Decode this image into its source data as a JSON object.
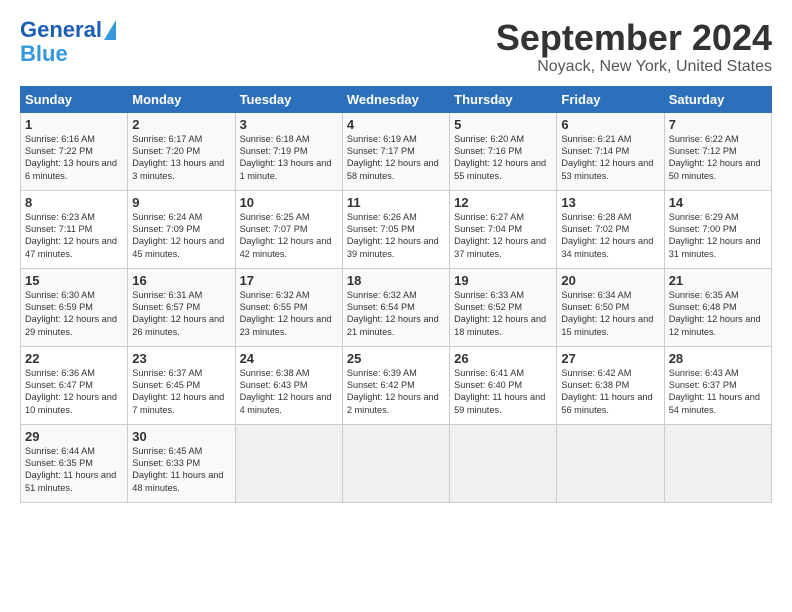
{
  "logo": {
    "line1": "General",
    "line2": "Blue"
  },
  "title": "September 2024",
  "subtitle": "Noyack, New York, United States",
  "days_of_week": [
    "Sunday",
    "Monday",
    "Tuesday",
    "Wednesday",
    "Thursday",
    "Friday",
    "Saturday"
  ],
  "weeks": [
    [
      {
        "day": "1",
        "sunrise": "6:16 AM",
        "sunset": "7:22 PM",
        "daylight": "13 hours and 6 minutes."
      },
      {
        "day": "2",
        "sunrise": "6:17 AM",
        "sunset": "7:20 PM",
        "daylight": "13 hours and 3 minutes."
      },
      {
        "day": "3",
        "sunrise": "6:18 AM",
        "sunset": "7:19 PM",
        "daylight": "13 hours and 1 minute."
      },
      {
        "day": "4",
        "sunrise": "6:19 AM",
        "sunset": "7:17 PM",
        "daylight": "12 hours and 58 minutes."
      },
      {
        "day": "5",
        "sunrise": "6:20 AM",
        "sunset": "7:16 PM",
        "daylight": "12 hours and 55 minutes."
      },
      {
        "day": "6",
        "sunrise": "6:21 AM",
        "sunset": "7:14 PM",
        "daylight": "12 hours and 53 minutes."
      },
      {
        "day": "7",
        "sunrise": "6:22 AM",
        "sunset": "7:12 PM",
        "daylight": "12 hours and 50 minutes."
      }
    ],
    [
      {
        "day": "8",
        "sunrise": "6:23 AM",
        "sunset": "7:11 PM",
        "daylight": "12 hours and 47 minutes."
      },
      {
        "day": "9",
        "sunrise": "6:24 AM",
        "sunset": "7:09 PM",
        "daylight": "12 hours and 45 minutes."
      },
      {
        "day": "10",
        "sunrise": "6:25 AM",
        "sunset": "7:07 PM",
        "daylight": "12 hours and 42 minutes."
      },
      {
        "day": "11",
        "sunrise": "6:26 AM",
        "sunset": "7:05 PM",
        "daylight": "12 hours and 39 minutes."
      },
      {
        "day": "12",
        "sunrise": "6:27 AM",
        "sunset": "7:04 PM",
        "daylight": "12 hours and 37 minutes."
      },
      {
        "day": "13",
        "sunrise": "6:28 AM",
        "sunset": "7:02 PM",
        "daylight": "12 hours and 34 minutes."
      },
      {
        "day": "14",
        "sunrise": "6:29 AM",
        "sunset": "7:00 PM",
        "daylight": "12 hours and 31 minutes."
      }
    ],
    [
      {
        "day": "15",
        "sunrise": "6:30 AM",
        "sunset": "6:59 PM",
        "daylight": "12 hours and 29 minutes."
      },
      {
        "day": "16",
        "sunrise": "6:31 AM",
        "sunset": "6:57 PM",
        "daylight": "12 hours and 26 minutes."
      },
      {
        "day": "17",
        "sunrise": "6:32 AM",
        "sunset": "6:55 PM",
        "daylight": "12 hours and 23 minutes."
      },
      {
        "day": "18",
        "sunrise": "6:32 AM",
        "sunset": "6:54 PM",
        "daylight": "12 hours and 21 minutes."
      },
      {
        "day": "19",
        "sunrise": "6:33 AM",
        "sunset": "6:52 PM",
        "daylight": "12 hours and 18 minutes."
      },
      {
        "day": "20",
        "sunrise": "6:34 AM",
        "sunset": "6:50 PM",
        "daylight": "12 hours and 15 minutes."
      },
      {
        "day": "21",
        "sunrise": "6:35 AM",
        "sunset": "6:48 PM",
        "daylight": "12 hours and 12 minutes."
      }
    ],
    [
      {
        "day": "22",
        "sunrise": "6:36 AM",
        "sunset": "6:47 PM",
        "daylight": "12 hours and 10 minutes."
      },
      {
        "day": "23",
        "sunrise": "6:37 AM",
        "sunset": "6:45 PM",
        "daylight": "12 hours and 7 minutes."
      },
      {
        "day": "24",
        "sunrise": "6:38 AM",
        "sunset": "6:43 PM",
        "daylight": "12 hours and 4 minutes."
      },
      {
        "day": "25",
        "sunrise": "6:39 AM",
        "sunset": "6:42 PM",
        "daylight": "12 hours and 2 minutes."
      },
      {
        "day": "26",
        "sunrise": "6:41 AM",
        "sunset": "6:40 PM",
        "daylight": "11 hours and 59 minutes."
      },
      {
        "day": "27",
        "sunrise": "6:42 AM",
        "sunset": "6:38 PM",
        "daylight": "11 hours and 56 minutes."
      },
      {
        "day": "28",
        "sunrise": "6:43 AM",
        "sunset": "6:37 PM",
        "daylight": "11 hours and 54 minutes."
      }
    ],
    [
      {
        "day": "29",
        "sunrise": "6:44 AM",
        "sunset": "6:35 PM",
        "daylight": "11 hours and 51 minutes."
      },
      {
        "day": "30",
        "sunrise": "6:45 AM",
        "sunset": "6:33 PM",
        "daylight": "11 hours and 48 minutes."
      },
      null,
      null,
      null,
      null,
      null
    ]
  ],
  "labels": {
    "sunrise": "Sunrise: ",
    "sunset": "Sunset: ",
    "daylight": "Daylight: "
  }
}
